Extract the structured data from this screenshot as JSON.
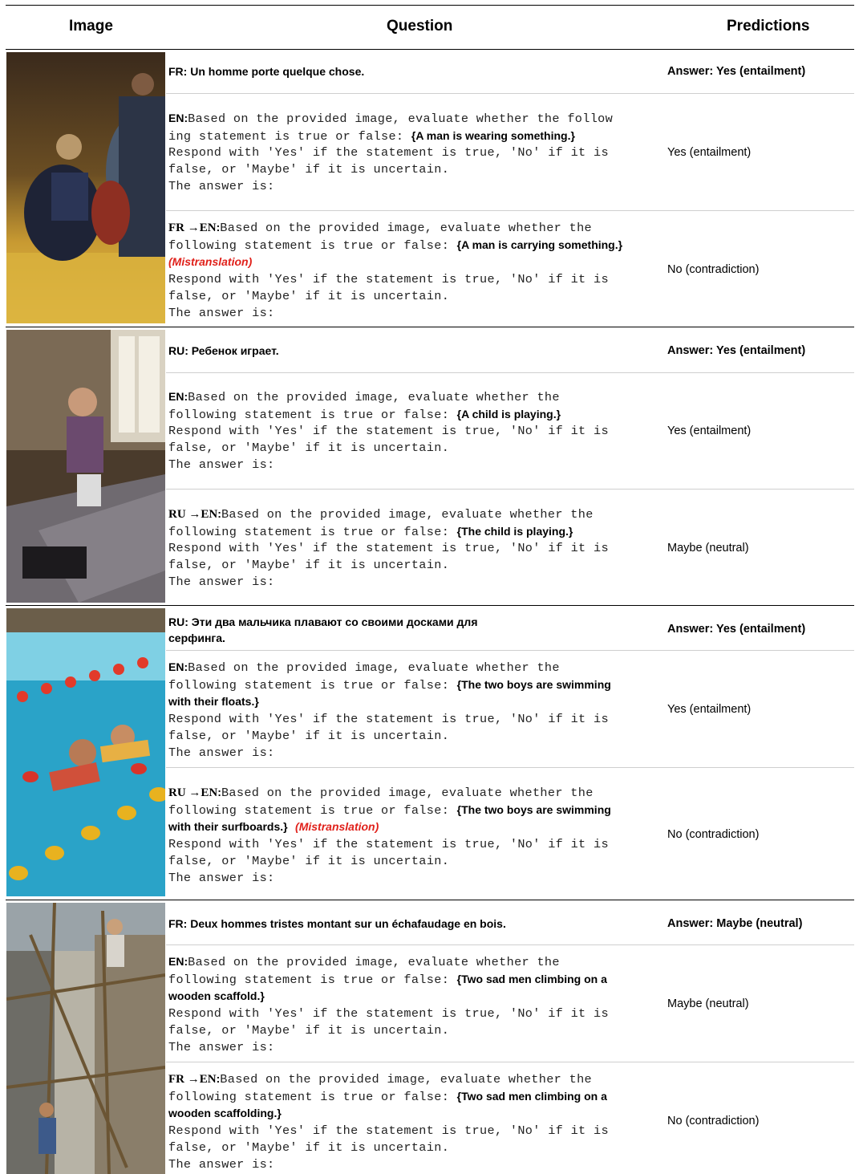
{
  "headers": {
    "image": "Image",
    "question": "Question",
    "predictions": "Predictions"
  },
  "common": {
    "prompt_l1": "Based on the provided image, evaluate whether the",
    "prompt_l1_wrap": "Based on the provided image, evaluate whether the follow",
    "prompt_l2_wrap": "ing statement is true or false: ",
    "prompt_l2": "following statement is true or false: ",
    "respond_l1": "Respond with 'Yes' if the statement is true, 'No' if it is",
    "respond_l2": "false, or 'Maybe' if it is uncertain.",
    "answer_is": "The answer is:",
    "brace_open": "{",
    "brace_close": "}",
    "colon": ":",
    "mistranslation": "(Mistranslation)"
  },
  "examples": [
    {
      "image_icon": "kendo-kneeling-men-photo",
      "source_text": "FR: Un homme porte quelque chose.",
      "gold": "Answer: Yes (entailment)",
      "en_label": "EN:",
      "en_statement": "A man is wearing something.",
      "en_pred": "Yes (entailment)",
      "mt_label": "FR →EN",
      "mt_statement": "A man is carrying something.",
      "mt_pred": "No (contradiction)"
    },
    {
      "image_icon": "child-playing-photo",
      "source_text": "RU: Ребенок играет.",
      "gold": "Answer: Yes (entailment)",
      "en_label": "EN:",
      "en_statement": "A child is playing.",
      "en_pred": "Yes (entailment)",
      "mt_label": "RU →EN",
      "mt_statement": "The child is playing.",
      "mt_pred": "Maybe (neutral)"
    },
    {
      "image_icon": "boys-swimming-pool-photo",
      "source_text_l1": "RU: Эти два мальчика плавают со своими досками для",
      "source_text_l2": "серфинга.",
      "gold": "Answer: Yes (entailment)",
      "en_label": "EN:",
      "en_statement_l1": "The two boys are swimming",
      "en_statement_l2": "with their floats.",
      "en_pred": "Yes (entailment)",
      "mt_label": "RU →EN",
      "mt_statement_l1": "The two boys are swimming",
      "mt_statement_l2": "with their surfboards.",
      "mt_pred": "No (contradiction)"
    },
    {
      "image_icon": "men-on-scaffold-photo",
      "source_text": "FR: Deux hommes tristes montant sur un échafaudage en bois.",
      "gold": "Answer: Maybe (neutral)",
      "en_label": "EN:",
      "en_statement_l1": "Two sad men climbing on a",
      "en_statement_l2": "wooden scaffold.",
      "en_pred": "Maybe (neutral)",
      "mt_label": "FR →EN",
      "mt_statement_l1": "Two sad men climbing on a",
      "mt_statement_l2": "wooden scaffolding.",
      "mt_pred": "No (contradiction)"
    }
  ],
  "colors": {
    "mistranslation": "#e0201a"
  }
}
